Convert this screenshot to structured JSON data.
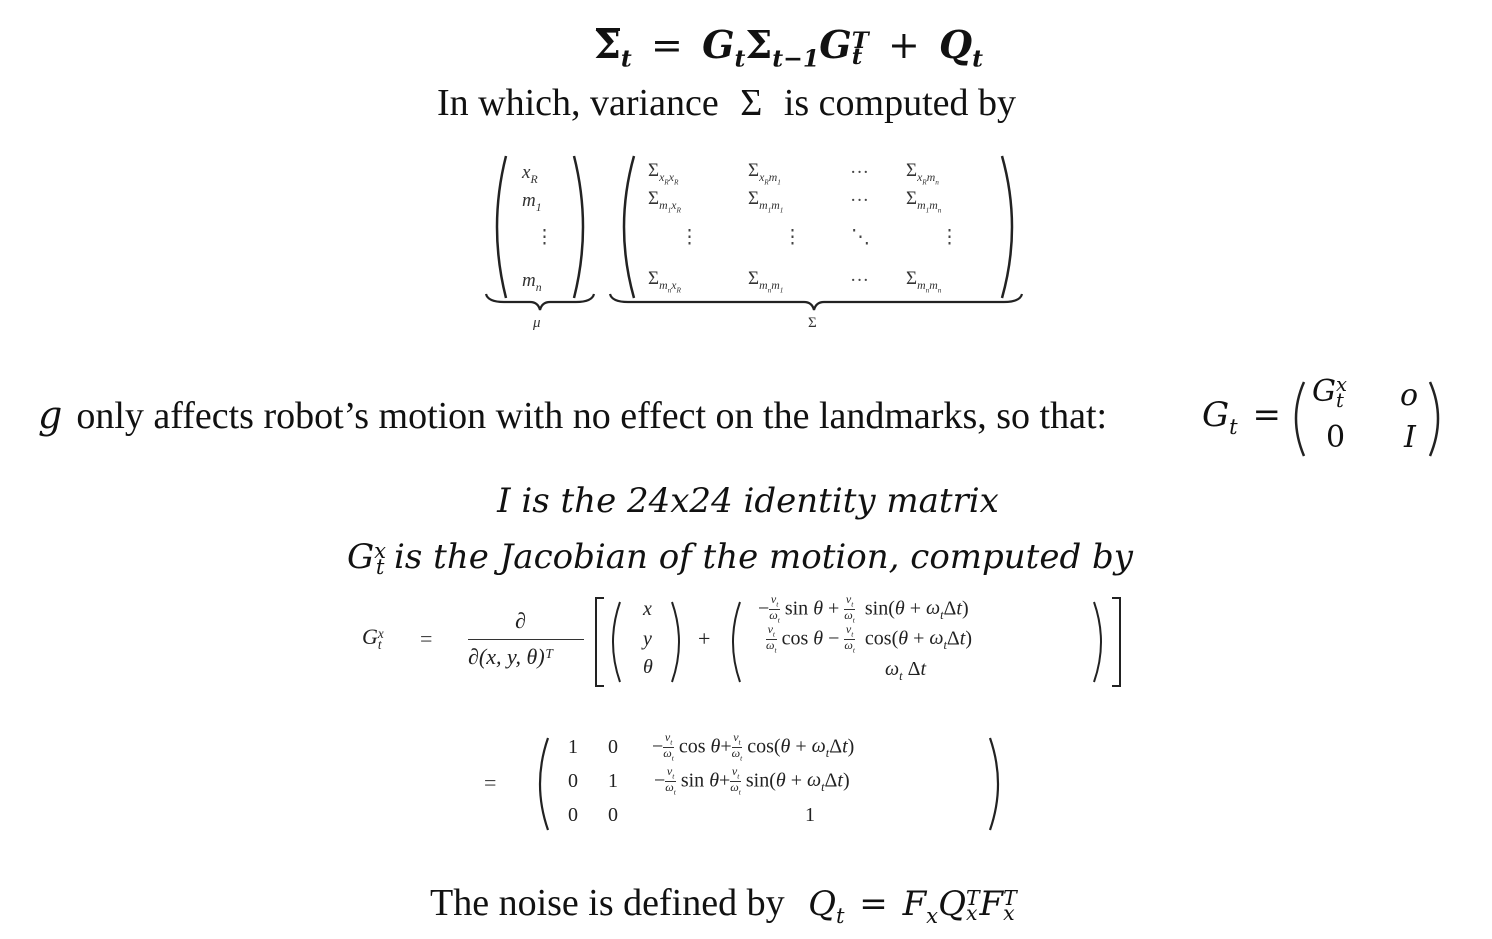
{
  "equation1": {
    "lhs": "Σ̄",
    "lhs_sub": "t",
    "eq": "=",
    "t1": "G",
    "t1_sub": "t",
    "t2": "Σ",
    "t2_sub": "t−1",
    "t3": "G",
    "t3_sup": "T",
    "t3_sub": "t",
    "plus": "+",
    "t4": "Q",
    "t4_sub": "t"
  },
  "line_variance": {
    "before": "In which, variance",
    "symbol": "Σ",
    "after": "is computed by"
  },
  "mu_vector": {
    "entries": [
      "x_R",
      "m_1",
      "⋮",
      "m_n"
    ],
    "label": "μ"
  },
  "sigma_matrix": {
    "rows": [
      [
        "Σ x_R x_R",
        "Σ x_R m_1",
        "···",
        "Σ x_R m_n"
      ],
      [
        "Σ m_1 x_R",
        "Σ m_1 m_1",
        "···",
        "Σ m_1 m_n"
      ],
      [
        "⋮",
        "⋮",
        "⋱",
        "⋮"
      ],
      [
        "Σ m_n x_R",
        "Σ m_n m_1",
        "···",
        "Σ m_n m_n"
      ]
    ],
    "label": "Σ"
  },
  "line_g": {
    "g": "g",
    "text": "only affects robot’s motion with no effect on the landmarks, so that:",
    "G": "G",
    "G_sub": "t",
    "eq": "=",
    "matrix": [
      [
        "G_t^x",
        "o"
      ],
      [
        "0",
        "I"
      ]
    ]
  },
  "line_identity": "I is the 24x24 identity matrix",
  "line_jacobian": {
    "G": "G",
    "sup": "x",
    "sub": "t",
    "text": "is the Jacobian of the motion, computed by"
  },
  "jacobian_eq": {
    "lhs": "G_t^x",
    "eq": "=",
    "numerator": "∂",
    "denominator": "∂(x, y, θ)ᵀ",
    "state_vector": [
      "x",
      "y",
      "θ"
    ],
    "plus": "+",
    "motion_vector": [
      "−(v_t/ω_t) sin θ + (v_t/ω_t) sin(θ + ω_t Δt)",
      "(v_t/ω_t) cos θ − (v_t/ω_t) cos(θ + ω_t Δt)",
      "ω_t Δt"
    ]
  },
  "jacobian_result": {
    "eq": "=",
    "rows": [
      [
        "1",
        "0",
        "−(v_t/ω_t) cos θ + (v_t/ω_t) cos(θ + ω_t Δt)"
      ],
      [
        "0",
        "1",
        "−(v_t/ω_t) sin θ + (v_t/ω_t) sin(θ + ω_t Δt)"
      ],
      [
        "0",
        "0",
        "1"
      ]
    ]
  },
  "line_noise": {
    "text": "The noise is defined by",
    "Q": "Q",
    "Q_sub": "t",
    "eq": "=",
    "F1": "F",
    "F1_sub": "x",
    "Q2": "Q",
    "Q2_sup": "T",
    "Q2_sub": "x",
    "F2": "F",
    "F2_sup": "T",
    "F2_sub": "x"
  }
}
